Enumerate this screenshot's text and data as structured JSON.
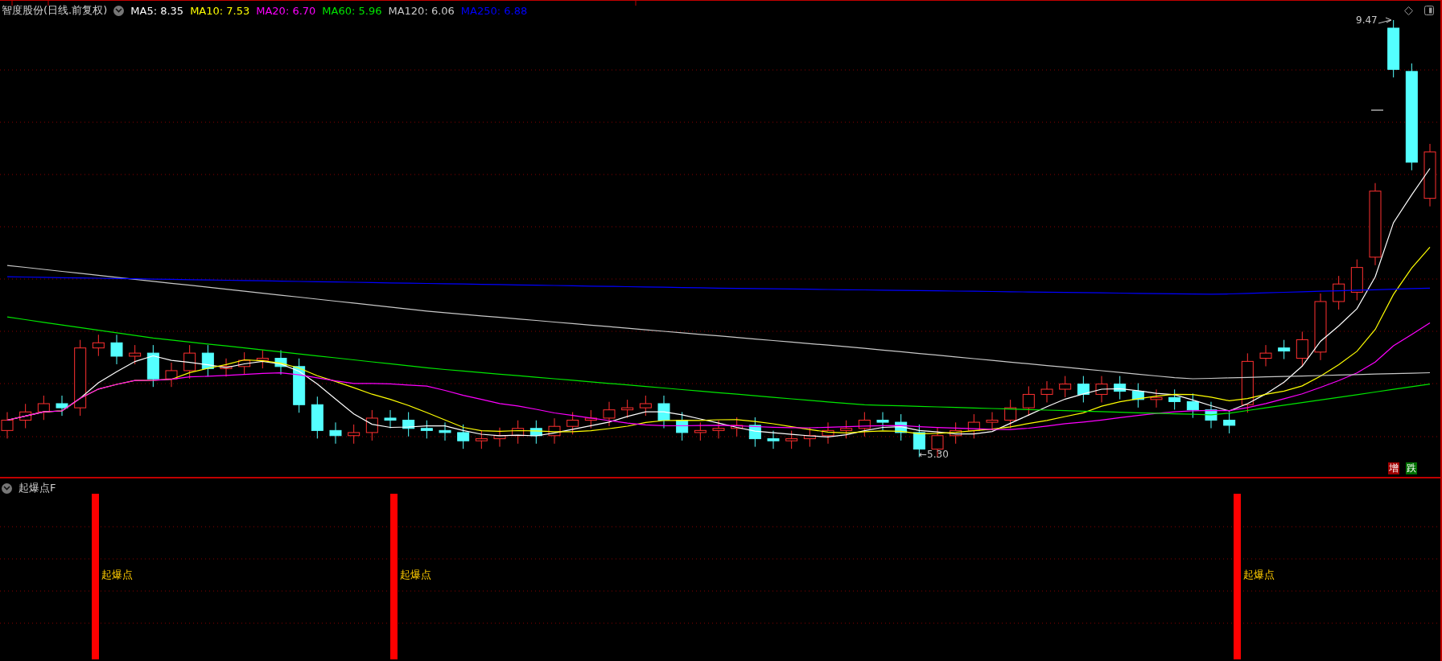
{
  "main_chart": {
    "title": "智度股份(日线.前复权)",
    "legend": [
      {
        "label": "MA5: 8.35",
        "color": "#ffffff"
      },
      {
        "label": "MA10: 7.53",
        "color": "#ffff00"
      },
      {
        "label": "MA20: 6.70",
        "color": "#ff00ff"
      },
      {
        "label": "MA60: 5.96",
        "color": "#00e600"
      },
      {
        "label": "MA120: 6.06",
        "color": "#c8c8c8"
      },
      {
        "label": "MA250: 6.88",
        "color": "#0000ff"
      }
    ],
    "high_label": "9.47",
    "low_label": "←5.30",
    "markers": [
      {
        "label": "增",
        "color": "#a00000"
      },
      {
        "label": "跌",
        "color": "#007000"
      }
    ]
  },
  "indicator": {
    "title": "起爆点F",
    "signals": [
      {
        "label": "起爆点"
      },
      {
        "label": "起爆点"
      },
      {
        "label": "起爆点"
      }
    ]
  }
}
